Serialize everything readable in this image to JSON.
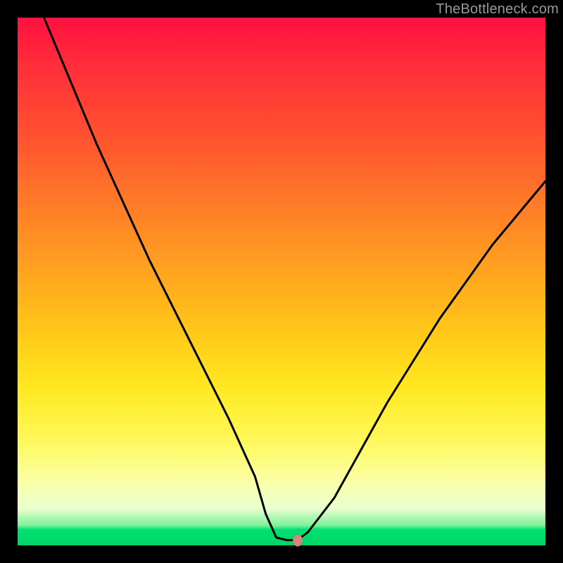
{
  "watermark": "TheBottleneck.com",
  "chart_data": {
    "type": "line",
    "title": "",
    "xlabel": "",
    "ylabel": "",
    "xlim": [
      0,
      100
    ],
    "ylim": [
      0,
      100
    ],
    "series": [
      {
        "name": "curve",
        "x": [
          5,
          10,
          15,
          20,
          25,
          30,
          35,
          40,
          45,
          47,
          49,
          51,
          53,
          55,
          60,
          65,
          70,
          75,
          80,
          85,
          90,
          95,
          100
        ],
        "y": [
          100,
          88,
          76,
          65,
          54,
          44,
          34,
          24,
          13,
          6,
          1.5,
          1.0,
          1.0,
          2.5,
          9,
          18,
          27,
          35,
          43,
          50,
          57,
          63,
          69
        ]
      }
    ],
    "marker": {
      "x": 53,
      "y": 1.0
    },
    "gradient_stops": [
      {
        "pos": 0,
        "color": "#ff1040"
      },
      {
        "pos": 50,
        "color": "#ffb020"
      },
      {
        "pos": 80,
        "color": "#fff85a"
      },
      {
        "pos": 97,
        "color": "#00e070"
      },
      {
        "pos": 100,
        "color": "#00d568"
      }
    ]
  }
}
